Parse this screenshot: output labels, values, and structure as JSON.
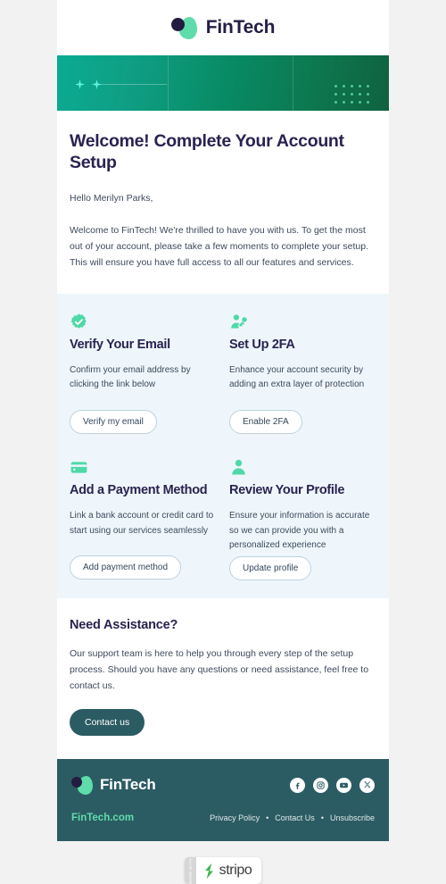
{
  "brand": {
    "name": "FinTech",
    "logo_icon": "fintech-logo-mark",
    "accent_green": "#5fdcab",
    "dark_navy": "#241e46",
    "footer_teal": "#2c5c63"
  },
  "banner": {
    "sparkle_icon": "sparkle-icon",
    "dot_grid_icon": "dot-grid-decoration"
  },
  "intro": {
    "heading": "Welcome! Complete Your Account Setup",
    "greeting": "Hello Merilyn Parks,",
    "body": "Welcome to FinTech! We're thrilled to have you with us. To get the most out of your account, please take a few moments to complete your setup. This will ensure you have full access to all our features and services."
  },
  "features": [
    {
      "icon": "verified-badge-icon",
      "title": "Verify Your Email",
      "desc": "Confirm your email address by clicking the link below",
      "button": "Verify my email"
    },
    {
      "icon": "user-key-icon",
      "title": "Set Up 2FA",
      "desc": "Enhance your account security by adding an extra layer of protection",
      "button": "Enable 2FA"
    },
    {
      "icon": "credit-card-icon",
      "title": "Add a Payment Method",
      "desc": "Link a bank account or credit card to start using our services seamlessly",
      "button": "Add payment method"
    },
    {
      "icon": "user-profile-icon",
      "title": "Review Your Profile",
      "desc": "Ensure your information is accurate so we can provide you with a personalized experience",
      "button": "Update profile"
    }
  ],
  "assistance": {
    "heading": "Need Assistance?",
    "body": "Our support team is here to help you through every step of the setup process. Should you have any questions or need assistance, feel free to contact us.",
    "button": "Contact us"
  },
  "footer": {
    "site_link": "FinTech.com",
    "socials": [
      {
        "icon": "facebook-icon"
      },
      {
        "icon": "instagram-icon"
      },
      {
        "icon": "youtube-icon"
      },
      {
        "icon": "x-twitter-icon"
      }
    ],
    "links": [
      {
        "label": "Privacy Policy"
      },
      {
        "label": "Contact Us"
      },
      {
        "label": "Unsubscribe"
      }
    ],
    "separator": "•"
  },
  "stripo": {
    "made_with": "MADE WITH",
    "name": "stripo",
    "logo_icon": "stripo-logo-icon"
  }
}
